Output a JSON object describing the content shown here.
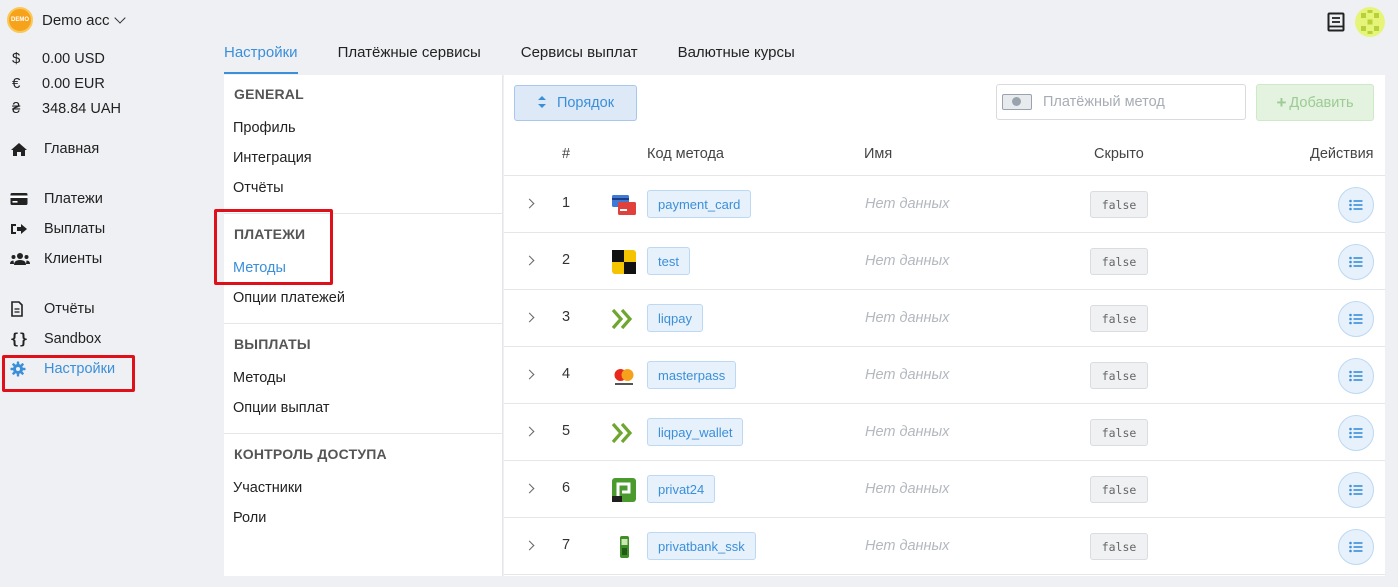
{
  "account": {
    "badge": "DEMO",
    "name": "Demo acc"
  },
  "balances": [
    {
      "symbol": "$",
      "amount": "0.00 USD"
    },
    {
      "symbol": "€",
      "amount": "0.00 EUR"
    },
    {
      "symbol": "₴",
      "amount": "348.84 UAH"
    }
  ],
  "nav": {
    "home": "Главная",
    "payments": "Платежи",
    "payouts": "Выплаты",
    "clients": "Клиенты",
    "reports": "Отчёты",
    "sandbox": "Sandbox",
    "settings": "Настройки"
  },
  "tabs": [
    "Настройки",
    "Платёжные сервисы",
    "Сервисы выплат",
    "Валютные курсы"
  ],
  "menu": {
    "general_title": "GENERAL",
    "profile": "Профиль",
    "integration": "Интеграция",
    "reports": "Отчёты",
    "payments_title": "ПЛАТЕЖИ",
    "payment_methods": "Методы",
    "payment_options": "Опции платежей",
    "payouts_title": "ВЫПЛАТЫ",
    "payout_methods": "Методы",
    "payout_options": "Опции выплат",
    "access_title": "КОНТРОЛЬ ДОСТУПА",
    "members": "Участники",
    "roles": "Роли"
  },
  "toolbar": {
    "order_label": "Порядок",
    "method_placeholder": "Платёжный метод",
    "add_label": "Добавить"
  },
  "table": {
    "columns": {
      "num": "#",
      "code": "Код метода",
      "name": "Имя",
      "hidden": "Скрыто",
      "actions": "Действия"
    },
    "rows": [
      {
        "num": "1",
        "logo": "card-icon",
        "code": "payment_card",
        "name": "Нет данных",
        "hidden": "false"
      },
      {
        "num": "2",
        "logo": "test-icon",
        "code": "test",
        "name": "Нет данных",
        "hidden": "false"
      },
      {
        "num": "3",
        "logo": "liqpay-icon",
        "code": "liqpay",
        "name": "Нет данных",
        "hidden": "false"
      },
      {
        "num": "4",
        "logo": "masterpass-icon",
        "code": "masterpass",
        "name": "Нет данных",
        "hidden": "false"
      },
      {
        "num": "5",
        "logo": "liqpay-icon",
        "code": "liqpay_wallet",
        "name": "Нет данных",
        "hidden": "false"
      },
      {
        "num": "6",
        "logo": "privat24-icon",
        "code": "privat24",
        "name": "Нет данных",
        "hidden": "false"
      },
      {
        "num": "7",
        "logo": "terminal-icon",
        "code": "privatbank_ssk",
        "name": "Нет данных",
        "hidden": "false"
      }
    ]
  },
  "colors": {
    "accent": "#3b8fd9",
    "highlight": "#e0101a",
    "success_disabled": "#9ccb93"
  }
}
